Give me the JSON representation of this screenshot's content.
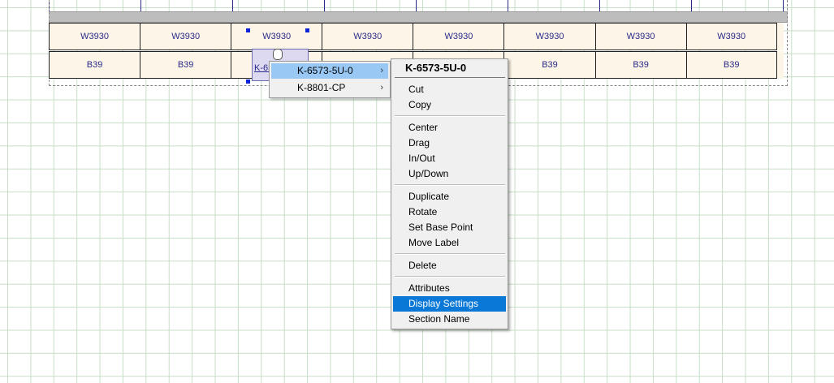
{
  "drawing": {
    "wall_row": [
      "W3930",
      "W3930",
      "W3930",
      "W3930",
      "W3930",
      "W3930",
      "W3930",
      "W3930"
    ],
    "base_row": [
      "B39",
      "B39",
      "",
      "",
      "",
      "B39",
      "B39",
      "B39"
    ],
    "selected_label": "K-65"
  },
  "submenu": {
    "items": [
      {
        "label": "K-6573-5U-0",
        "arrow": "›"
      },
      {
        "label": "K-8801-CP",
        "arrow": "›"
      }
    ]
  },
  "context_menu": {
    "title": "K-6573-5U-0",
    "items": [
      {
        "label": "Cut"
      },
      {
        "label": "Copy"
      },
      {
        "label": "Center"
      },
      {
        "label": "Drag"
      },
      {
        "label": "In/Out"
      },
      {
        "label": "Up/Down"
      },
      {
        "label": "Duplicate"
      },
      {
        "label": "Rotate"
      },
      {
        "label": "Set Base Point"
      },
      {
        "label": "Move Label"
      },
      {
        "label": "Delete"
      },
      {
        "label": "Attributes"
      },
      {
        "label": "Display Settings"
      },
      {
        "label": "Section Name"
      }
    ]
  }
}
